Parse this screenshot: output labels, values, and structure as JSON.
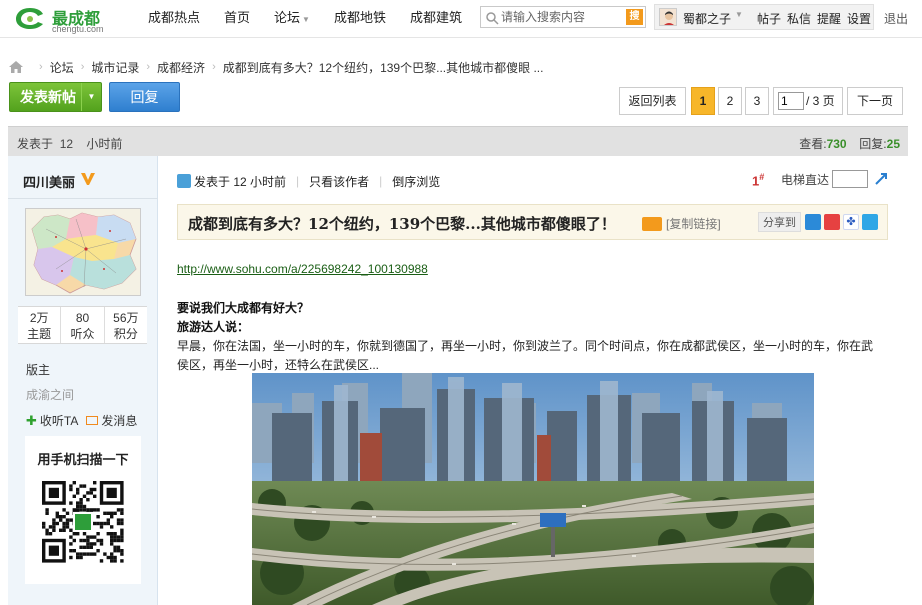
{
  "site": {
    "logo_name": "最成都",
    "logo_sub": "chengtu.com",
    "nav": [
      {
        "label": "成都热点",
        "caret": false
      },
      {
        "label": "首页",
        "caret": false
      },
      {
        "label": "论坛",
        "caret": true
      },
      {
        "label": "成都地铁",
        "caret": false
      },
      {
        "label": "成都建筑",
        "caret": false
      }
    ],
    "search": {
      "placeholder": "请输入搜索内容",
      "button": "搜"
    },
    "user": {
      "name": "蜀都之子",
      "links": [
        "帖子",
        "私信",
        "提醒",
        "设置"
      ]
    },
    "logout": "退出"
  },
  "breadcrumb": [
    "论坛",
    "城市记录",
    "成都经济",
    "成都到底有多大？12个纽约，139个巴黎...其他城市都傻眼 ..."
  ],
  "actions": {
    "new_post": "发表新帖",
    "reply": "回复"
  },
  "pager": {
    "back": "返回列表",
    "pages": [
      "1",
      "2",
      "3"
    ],
    "current": "1",
    "input_value": "1",
    "total": "/ 3 页",
    "next": "下一页"
  },
  "thread": {
    "posted_label": "发表于",
    "posted_value": "12",
    "posted_unit": "小时前",
    "views_label": "查看:",
    "views": "730",
    "replies_label": "回复:",
    "replies": "25"
  },
  "author": {
    "name": "四川美丽",
    "stats": [
      {
        "value": "2万",
        "label": "主题"
      },
      {
        "value": "80",
        "label": "听众"
      },
      {
        "value": "56万",
        "label": "积分"
      }
    ],
    "rank": "版主",
    "rank_name": "成渝之间",
    "follow": "收听TA",
    "message": "发消息",
    "qr_title": "用手机扫描一下"
  },
  "post": {
    "meta_posted": "发表于 12 小时前",
    "only_author": "只看该作者",
    "reverse": "倒序浏览",
    "floor": "1",
    "floor_mark": "#",
    "jump_label": "电梯直达",
    "title": "成都到底有多大？12个纽约，139个巴黎...其他城市都傻眼了！",
    "copy_link": "[复制链接]",
    "share_label": "分享到",
    "link": "http://www.sohu.com/a/225698242_100130988",
    "heading1": "要说我们大成都有好大？",
    "heading2": "旅游达人说：",
    "paragraph": "早晨，你在法国，坐一小时的车，你就到德国了，再坐一小时，你到波兰了。同个时间点，你在成都武侯区，坐一小时的车，你在武侯区，再坐一小时，还特么在武侯区..."
  },
  "colors": {
    "brand_green": "#2e9e3a",
    "accent_orange": "#f7b62a",
    "reply_blue": "#2f7fcf",
    "link_green": "#1a5e15"
  }
}
